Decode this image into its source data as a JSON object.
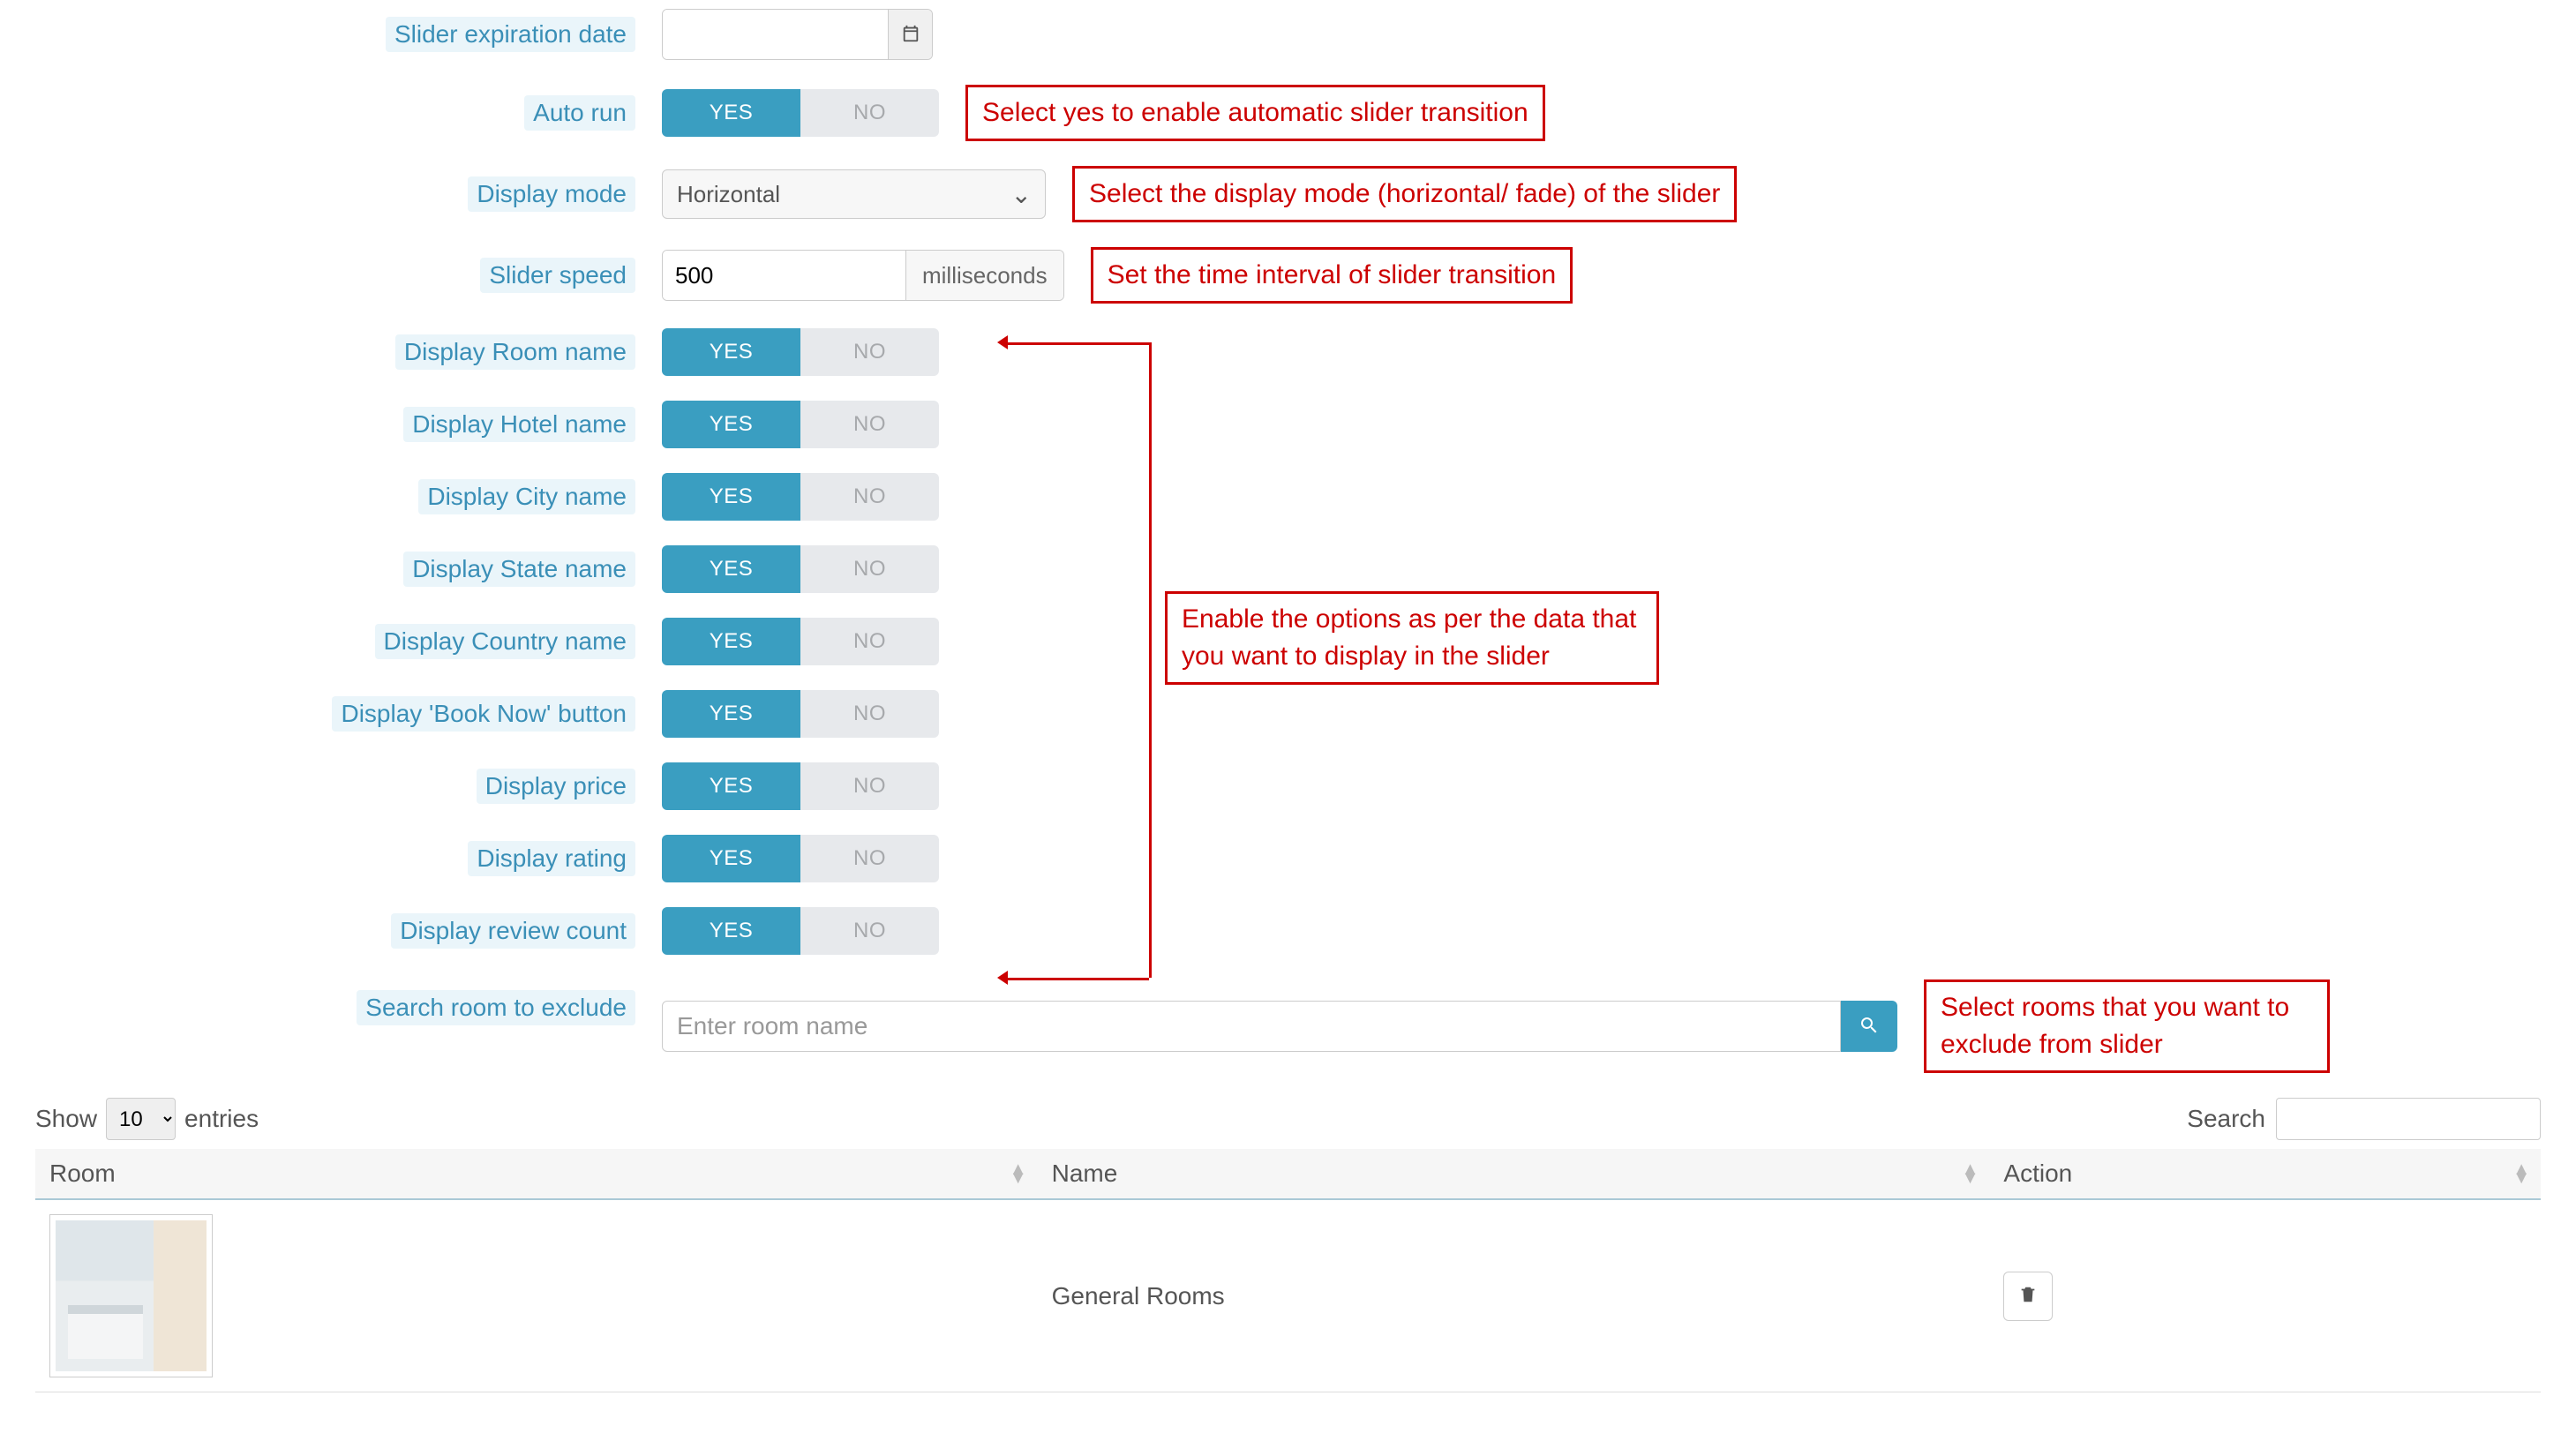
{
  "form": {
    "expiration": {
      "label": "Slider expiration date",
      "value": ""
    },
    "autorun": {
      "label": "Auto run",
      "yes": "YES",
      "no": "NO"
    },
    "mode": {
      "label": "Display mode",
      "value": "Horizontal"
    },
    "speed": {
      "label": "Slider speed",
      "value": "500",
      "unit": "milliseconds"
    },
    "room": {
      "label": "Display Room name",
      "yes": "YES",
      "no": "NO"
    },
    "hotel": {
      "label": "Display Hotel name",
      "yes": "YES",
      "no": "NO"
    },
    "city": {
      "label": "Display City name",
      "yes": "YES",
      "no": "NO"
    },
    "state": {
      "label": "Display State name",
      "yes": "YES",
      "no": "NO"
    },
    "country": {
      "label": "Display Country name",
      "yes": "YES",
      "no": "NO"
    },
    "booknow": {
      "label": "Display 'Book Now' button",
      "yes": "YES",
      "no": "NO"
    },
    "price": {
      "label": "Display price",
      "yes": "YES",
      "no": "NO"
    },
    "rating": {
      "label": "Display rating",
      "yes": "YES",
      "no": "NO"
    },
    "review": {
      "label": "Display review count",
      "yes": "YES",
      "no": "NO"
    },
    "exclude": {
      "label": "Search room to exclude",
      "placeholder": "Enter room name"
    }
  },
  "callouts": {
    "autorun": "Select yes to enable automatic slider transition",
    "mode": "Select the display mode (horizontal/ fade) of the slider",
    "speed": "Set the time interval of slider transition",
    "display": "Enable the options as per the data that you want to display in the slider",
    "exclude": "Select rooms that you want to exclude from slider"
  },
  "table": {
    "show_pre": "Show",
    "show_post": "entries",
    "page_size": "10",
    "search_label": "Search",
    "columns": {
      "room": "Room",
      "name": "Name",
      "action": "Action"
    },
    "rows": [
      {
        "name": "General Rooms"
      }
    ]
  }
}
